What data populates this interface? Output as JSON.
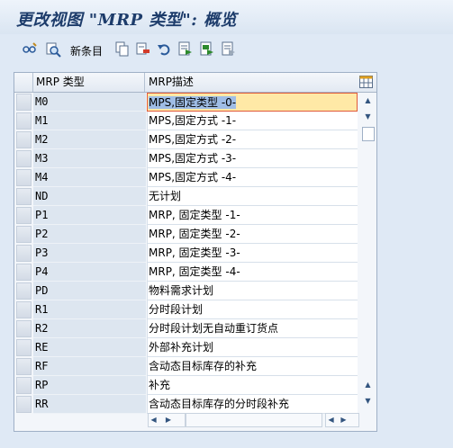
{
  "window": {
    "title": "更改视图 \"MRP 类型\": 概览"
  },
  "toolbar": {
    "new_entries_label": "新条目",
    "icons": [
      "display-change-icon",
      "find-icon",
      "copy-icon",
      "delete-icon",
      "undo-icon",
      "select-all-icon",
      "select-block-icon",
      "deselect-all-icon"
    ]
  },
  "table": {
    "columns": [
      "MRP 类型",
      "MRP描述"
    ],
    "rows": [
      {
        "code": "M0",
        "desc": "MPS,固定类型 -0-"
      },
      {
        "code": "M1",
        "desc": "MPS,固定方式 -1-"
      },
      {
        "code": "M2",
        "desc": "MPS,固定方式 -2-"
      },
      {
        "code": "M3",
        "desc": "MPS,固定方式 -3-"
      },
      {
        "code": "M4",
        "desc": "MPS,固定方式 -4-"
      },
      {
        "code": "ND",
        "desc": "无计划"
      },
      {
        "code": "P1",
        "desc": "MRP, 固定类型 -1-"
      },
      {
        "code": "P2",
        "desc": "MRP, 固定类型 -2-"
      },
      {
        "code": "P3",
        "desc": "MRP, 固定类型 -3-"
      },
      {
        "code": "P4",
        "desc": "MRP, 固定类型 -4-"
      },
      {
        "code": "PD",
        "desc": "物料需求计划"
      },
      {
        "code": "R1",
        "desc": "分时段计划"
      },
      {
        "code": "R2",
        "desc": "分时段计划无自动重订货点"
      },
      {
        "code": "RE",
        "desc": "外部补充计划"
      },
      {
        "code": "RF",
        "desc": "含动态目标库存的补充"
      },
      {
        "code": "RP",
        "desc": "补充"
      },
      {
        "code": "RR",
        "desc": "含动态目标库存的分时段补充"
      }
    ]
  },
  "colors": {
    "title": "#1d3c6b",
    "selection": "#ffe9a6",
    "key_column": "#dde6f0"
  }
}
